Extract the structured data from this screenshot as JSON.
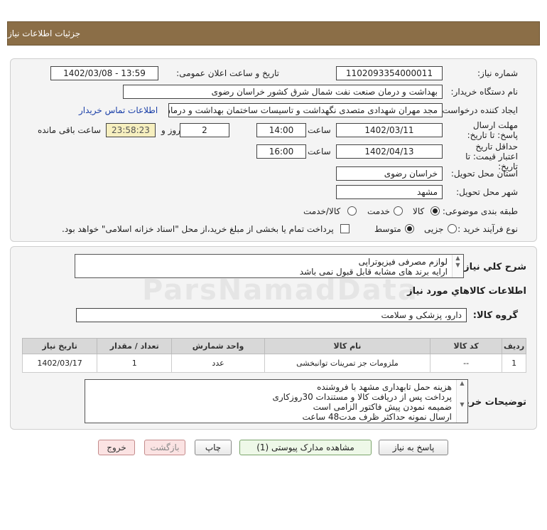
{
  "header": {
    "title": "جزئیات اطلاعات نیاز"
  },
  "form": {
    "need_number": {
      "label": "شماره نیاز:",
      "value": "1102093354000011"
    },
    "announce_datetime": {
      "label": "تاریخ و ساعت اعلان عمومی:",
      "value": "1402/03/08 - 13:59"
    },
    "buyer_org": {
      "label": "نام دستگاه خریدار:",
      "value": "بهداشت و درمان صنعت نفت شمال شرق کشور   خراسان رضوی"
    },
    "requester": {
      "label": "ایجاد کننده درخواست:",
      "value": "مجد مهران شهدادی متصدی نگهداشت و تاسیسات ساختمان بهداشت و درمان",
      "contact_link": "اطلاعات تماس خریدار"
    },
    "reply_deadline": {
      "label": "مهلت ارسال پاسخ: تا تاریخ:",
      "date": "1402/03/11",
      "time_label": "ساعت",
      "time": "14:00",
      "days": "2",
      "days_label": "روز و",
      "remaining": "23:58:23",
      "remaining_label": "ساعت باقی مانده"
    },
    "price_validity": {
      "label": "حداقل تاریخ اعتبار قیمت: تا تاریخ:",
      "date": "1402/04/13",
      "time_label": "ساعت",
      "time": "16:00"
    },
    "delivery_province": {
      "label": "استان محل تحویل:",
      "value": "خراسان رضوی"
    },
    "delivery_city": {
      "label": "شهر محل تحویل:",
      "value": "مشهد"
    },
    "category": {
      "label": "طبقه بندی موضوعی:",
      "options": [
        "کالا",
        "خدمت",
        "کالا/خدمت"
      ],
      "selected": "کالا"
    },
    "purchase_process": {
      "label": "نوع فرآیند خرید :",
      "options": [
        "جزیی",
        "متوسط"
      ],
      "selected": "متوسط",
      "payment_note": "پرداخت تمام یا بخشی از مبلغ خرید،از محل \"اسناد خزانه اسلامی\" خواهد بود."
    }
  },
  "details": {
    "summary_label": "شرح کلي نياز:",
    "summary_lines": [
      "لوازم مصرفی فیزیوتراپی",
      "ارایه برند های مشابه قابل قبول نمی باشد"
    ],
    "goods_info_title": "اطلاعات کالاهاي مورد نياز",
    "goods_group_label": "گروه کالا:",
    "goods_group_value": "دارو، پزشکی و سلامت",
    "table": {
      "headers": [
        "ردیف",
        "کد کالا",
        "نام کالا",
        "واحد شمارش",
        "تعداد / مقدار",
        "تاریخ نیاز"
      ],
      "rows": [
        [
          "1",
          "--",
          "ملزومات جز تمرینات توانبخشی",
          "عدد",
          "1",
          "1402/03/17"
        ]
      ]
    },
    "buyer_notes_label": "توضیحات خریدار:",
    "buyer_notes_lines": [
      "هزینه حمل تابهداری مشهد با فروشنده",
      "پرداخت پس از دریافت کالا و مستندات 30روزکاری",
      "ضمیمه نمودن پیش فاکتور الزامی است",
      "ارسال نمونه حداکثر ظرف مدت48 ساعت"
    ]
  },
  "buttons": {
    "reply": "پاسخ به نیاز",
    "attachments": "مشاهده مدارک پیوستی (1)",
    "print": "چاپ",
    "back": "بازگشت",
    "exit": "خروج"
  },
  "watermark": "ParsNamadData"
}
